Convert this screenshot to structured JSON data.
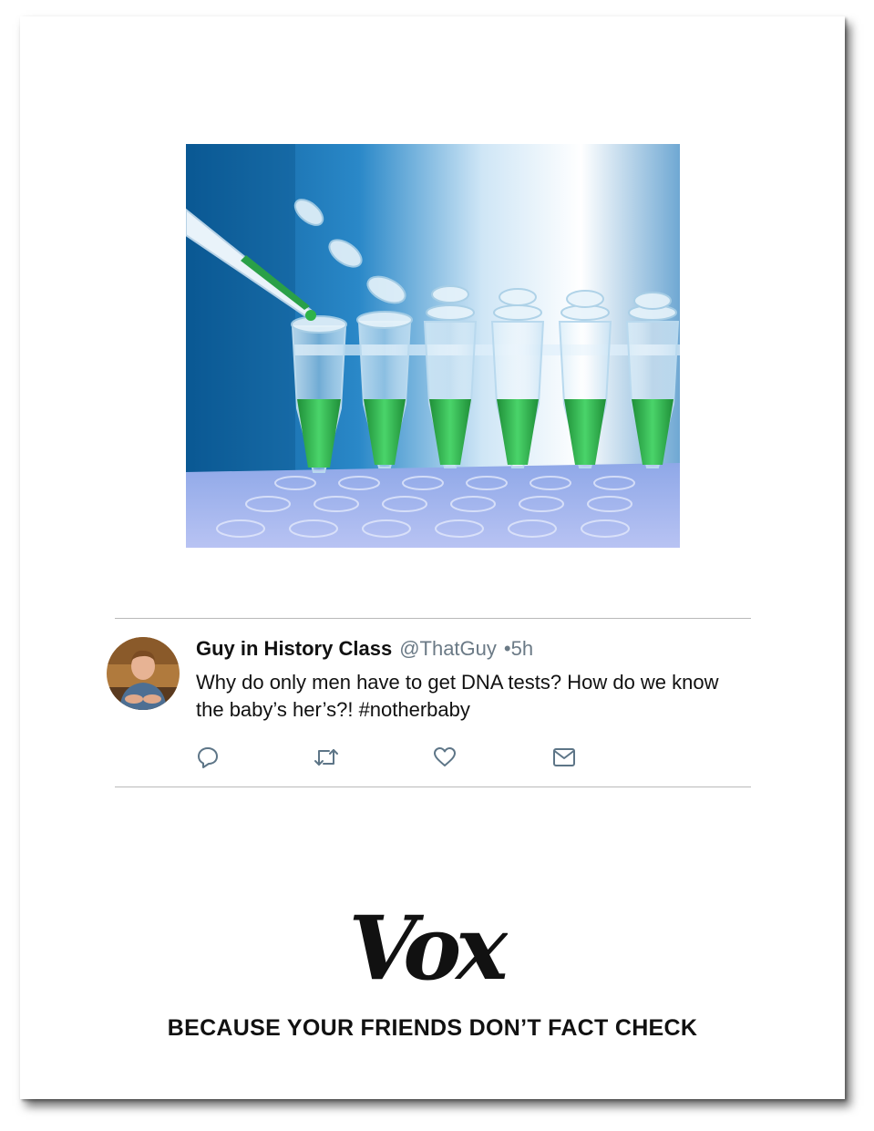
{
  "tweet": {
    "display_name": "Guy in History Class",
    "handle": "@ThatGuy",
    "timestamp": "•5h",
    "text": "Why do only men have to get DNA tests? How do we know the baby’s her’s?! #notherbaby"
  },
  "actions": {
    "reply_icon": "speech-bubble",
    "retweet_icon": "retweet-arrows",
    "like_icon": "heart",
    "message_icon": "envelope"
  },
  "brand": {
    "logo_text": "Vox",
    "tagline": "BECAUSE YOUR FRIENDS DON’T FACT CHECK"
  },
  "colors": {
    "icon": "#5d7587",
    "secondary_text": "#6b7a86",
    "test_liquid": "#2fb34a"
  }
}
